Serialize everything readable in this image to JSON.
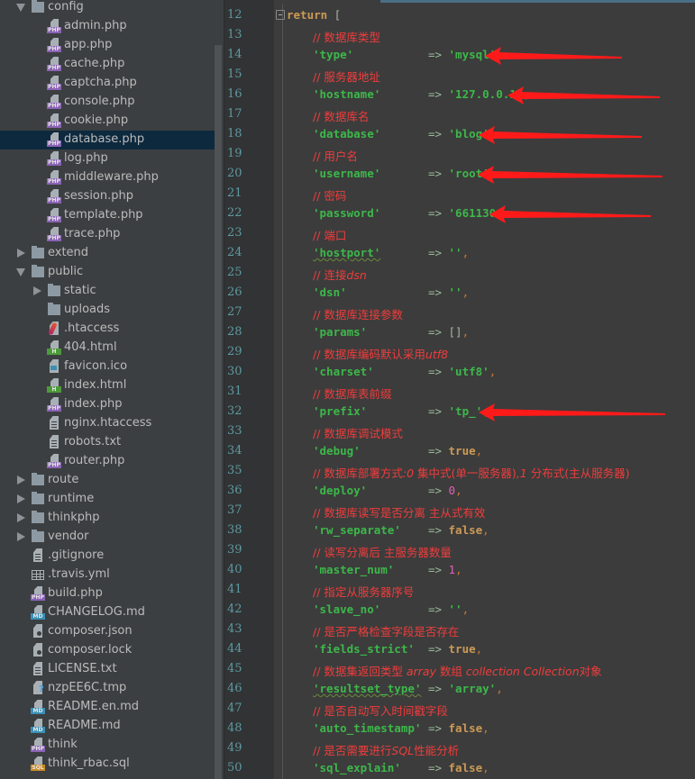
{
  "project_tree": {
    "items": [
      {
        "label": "config",
        "type": "folder",
        "expanded": true,
        "depth": 1
      },
      {
        "label": "admin.php",
        "type": "php",
        "depth": 2
      },
      {
        "label": "app.php",
        "type": "php",
        "depth": 2
      },
      {
        "label": "cache.php",
        "type": "php",
        "depth": 2
      },
      {
        "label": "captcha.php",
        "type": "php",
        "depth": 2
      },
      {
        "label": "console.php",
        "type": "php",
        "depth": 2
      },
      {
        "label": "cookie.php",
        "type": "php",
        "depth": 2
      },
      {
        "label": "database.php",
        "type": "php",
        "depth": 2,
        "selected": true
      },
      {
        "label": "log.php",
        "type": "php",
        "depth": 2
      },
      {
        "label": "middleware.php",
        "type": "php",
        "depth": 2
      },
      {
        "label": "session.php",
        "type": "php",
        "depth": 2
      },
      {
        "label": "template.php",
        "type": "php",
        "depth": 2
      },
      {
        "label": "trace.php",
        "type": "php",
        "depth": 2
      },
      {
        "label": "extend",
        "type": "folder",
        "expanded": false,
        "depth": 1
      },
      {
        "label": "public",
        "type": "folder",
        "expanded": true,
        "depth": 1
      },
      {
        "label": "static",
        "type": "folder",
        "expanded": false,
        "depth": 2
      },
      {
        "label": "uploads",
        "type": "folder-empty",
        "depth": 2
      },
      {
        "label": ".htaccess",
        "type": "apache",
        "depth": 2
      },
      {
        "label": "404.html",
        "type": "html",
        "depth": 2
      },
      {
        "label": "favicon.ico",
        "type": "image",
        "depth": 2
      },
      {
        "label": "index.html",
        "type": "html",
        "depth": 2
      },
      {
        "label": "index.php",
        "type": "php",
        "depth": 2
      },
      {
        "label": "nginx.htaccess",
        "type": "text",
        "depth": 2
      },
      {
        "label": "robots.txt",
        "type": "text",
        "depth": 2
      },
      {
        "label": "router.php",
        "type": "php",
        "depth": 2
      },
      {
        "label": "route",
        "type": "folder",
        "expanded": false,
        "depth": 1
      },
      {
        "label": "runtime",
        "type": "folder",
        "expanded": false,
        "depth": 1
      },
      {
        "label": "thinkphp",
        "type": "folder",
        "expanded": false,
        "depth": 1
      },
      {
        "label": "vendor",
        "type": "folder",
        "expanded": false,
        "depth": 1
      },
      {
        "label": ".gitignore",
        "type": "text",
        "depth": 1
      },
      {
        "label": ".travis.yml",
        "type": "yml",
        "depth": 1
      },
      {
        "label": "build.php",
        "type": "php",
        "depth": 1
      },
      {
        "label": "CHANGELOG.md",
        "type": "md",
        "depth": 1
      },
      {
        "label": "composer.json",
        "type": "composer",
        "depth": 1
      },
      {
        "label": "composer.lock",
        "type": "composer",
        "depth": 1
      },
      {
        "label": "LICENSE.txt",
        "type": "text",
        "depth": 1
      },
      {
        "label": "nzpEE6C.tmp",
        "type": "unknown",
        "depth": 1
      },
      {
        "label": "README.en.md",
        "type": "md",
        "depth": 1
      },
      {
        "label": "README.md",
        "type": "md",
        "depth": 1
      },
      {
        "label": "think",
        "type": "php",
        "depth": 1
      },
      {
        "label": "think_rbac.sql",
        "type": "sql",
        "depth": 1
      }
    ],
    "badges": {
      "php": "PHP",
      "html": "H",
      "md": "MD",
      "sql": "SQL"
    },
    "badge_colors": {
      "php": "#8a63b5",
      "html": "#4c9a3a",
      "md": "#3a8fb5",
      "sql": "#c98b25"
    }
  },
  "editor": {
    "lines": [
      {
        "n": "12",
        "tokens": [
          {
            "t": "return",
            "c": "kw"
          },
          {
            "t": " [",
            "c": "brk"
          }
        ],
        "fold": true
      },
      {
        "n": "13",
        "tokens": [
          {
            "t": "// 数据库类型",
            "c": "cm"
          }
        ]
      },
      {
        "n": "14",
        "tokens": [
          {
            "t": "'type'",
            "c": "str"
          },
          {
            "t": "           => ",
            "c": "op"
          },
          {
            "t": "'mysql'",
            "c": "str"
          },
          {
            "t": ",",
            "c": "punc"
          }
        ]
      },
      {
        "n": "15",
        "tokens": [
          {
            "t": "// 服务器地址",
            "c": "cm"
          }
        ]
      },
      {
        "n": "16",
        "tokens": [
          {
            "t": "'hostname'",
            "c": "str"
          },
          {
            "t": "       => ",
            "c": "op"
          },
          {
            "t": "'127.0.0.1'",
            "c": "str"
          },
          {
            "t": ",",
            "c": "punc"
          }
        ]
      },
      {
        "n": "17",
        "tokens": [
          {
            "t": "// 数据库名",
            "c": "cm"
          }
        ]
      },
      {
        "n": "18",
        "tokens": [
          {
            "t": "'database'",
            "c": "str"
          },
          {
            "t": "       => ",
            "c": "op"
          },
          {
            "t": "'blog'",
            "c": "str"
          },
          {
            "t": ",",
            "c": "punc"
          }
        ]
      },
      {
        "n": "19",
        "tokens": [
          {
            "t": "// 用户名",
            "c": "cm"
          }
        ]
      },
      {
        "n": "20",
        "tokens": [
          {
            "t": "'username'",
            "c": "str"
          },
          {
            "t": "       => ",
            "c": "op"
          },
          {
            "t": "'root'",
            "c": "str"
          },
          {
            "t": ",",
            "c": "punc"
          }
        ]
      },
      {
        "n": "21",
        "tokens": [
          {
            "t": "// 密码",
            "c": "cm"
          }
        ]
      },
      {
        "n": "22",
        "tokens": [
          {
            "t": "'password'",
            "c": "str"
          },
          {
            "t": "       => ",
            "c": "op"
          },
          {
            "t": "'661130'",
            "c": "str"
          }
        ]
      },
      {
        "n": "23",
        "tokens": [
          {
            "t": "// 端口",
            "c": "cm"
          }
        ]
      },
      {
        "n": "24",
        "tokens": [
          {
            "t": "'hostport'",
            "c": "str squig"
          },
          {
            "t": "       => ",
            "c": "op"
          },
          {
            "t": "''",
            "c": "str"
          },
          {
            "t": ",",
            "c": "punc"
          }
        ]
      },
      {
        "n": "25",
        "tokens": [
          {
            "t": "// 连接",
            "c": "cm"
          },
          {
            "t": "dsn",
            "c": "cm-i"
          }
        ]
      },
      {
        "n": "26",
        "tokens": [
          {
            "t": "'dsn'",
            "c": "str"
          },
          {
            "t": "            => ",
            "c": "op"
          },
          {
            "t": "''",
            "c": "str"
          },
          {
            "t": ",",
            "c": "punc"
          }
        ]
      },
      {
        "n": "27",
        "tokens": [
          {
            "t": "// 数据库连接参数",
            "c": "cm"
          }
        ]
      },
      {
        "n": "28",
        "tokens": [
          {
            "t": "'params'",
            "c": "str"
          },
          {
            "t": "         => ",
            "c": "op"
          },
          {
            "t": "[]",
            "c": "brk"
          },
          {
            "t": ",",
            "c": "punc"
          }
        ]
      },
      {
        "n": "29",
        "tokens": [
          {
            "t": "// 数据库编码默认采用",
            "c": "cm"
          },
          {
            "t": "utf8",
            "c": "cm-i"
          }
        ]
      },
      {
        "n": "30",
        "tokens": [
          {
            "t": "'charset'",
            "c": "str"
          },
          {
            "t": "        => ",
            "c": "op"
          },
          {
            "t": "'utf8'",
            "c": "str"
          },
          {
            "t": ",",
            "c": "punc"
          }
        ]
      },
      {
        "n": "31",
        "tokens": [
          {
            "t": "// 数据库表前缀",
            "c": "cm"
          }
        ]
      },
      {
        "n": "32",
        "tokens": [
          {
            "t": "'prefix'",
            "c": "str"
          },
          {
            "t": "         => ",
            "c": "op"
          },
          {
            "t": "'tp_'",
            "c": "str"
          },
          {
            "t": ",",
            "c": "punc"
          }
        ]
      },
      {
        "n": "33",
        "tokens": [
          {
            "t": "// 数据库调试模式",
            "c": "cm"
          }
        ]
      },
      {
        "n": "34",
        "tokens": [
          {
            "t": "'debug'",
            "c": "str"
          },
          {
            "t": "          => ",
            "c": "op"
          },
          {
            "t": "true",
            "c": "bool"
          },
          {
            "t": ",",
            "c": "punc"
          }
        ]
      },
      {
        "n": "35",
        "tokens": [
          {
            "t": "// 数据库部署方式",
            "c": "cm"
          },
          {
            "t": ":0 ",
            "c": "cm-i"
          },
          {
            "t": "集中式(单一服务器)",
            "c": "cm"
          },
          {
            "t": ",1 ",
            "c": "cm-i"
          },
          {
            "t": "分布式(主从服务器)",
            "c": "cm"
          }
        ]
      },
      {
        "n": "36",
        "tokens": [
          {
            "t": "'deploy'",
            "c": "str"
          },
          {
            "t": "         => ",
            "c": "op"
          },
          {
            "t": "0",
            "c": "num"
          },
          {
            "t": ",",
            "c": "punc"
          }
        ]
      },
      {
        "n": "37",
        "tokens": [
          {
            "t": "// 数据库读写是否分离 主从式有效",
            "c": "cm"
          }
        ]
      },
      {
        "n": "38",
        "tokens": [
          {
            "t": "'rw_separate'",
            "c": "str"
          },
          {
            "t": "    => ",
            "c": "op"
          },
          {
            "t": "false",
            "c": "bool"
          },
          {
            "t": ",",
            "c": "punc"
          }
        ]
      },
      {
        "n": "39",
        "tokens": [
          {
            "t": "// 读写分离后 主服务器数量",
            "c": "cm"
          }
        ]
      },
      {
        "n": "40",
        "tokens": [
          {
            "t": "'master_num'",
            "c": "str"
          },
          {
            "t": "     => ",
            "c": "op"
          },
          {
            "t": "1",
            "c": "num"
          },
          {
            "t": ",",
            "c": "punc"
          }
        ]
      },
      {
        "n": "41",
        "tokens": [
          {
            "t": "// 指定从服务器序号",
            "c": "cm"
          }
        ]
      },
      {
        "n": "42",
        "tokens": [
          {
            "t": "'slave_no'",
            "c": "str"
          },
          {
            "t": "       => ",
            "c": "op"
          },
          {
            "t": "''",
            "c": "str"
          },
          {
            "t": ",",
            "c": "punc"
          }
        ]
      },
      {
        "n": "43",
        "tokens": [
          {
            "t": "// 是否严格检查字段是否存在",
            "c": "cm"
          }
        ]
      },
      {
        "n": "44",
        "tokens": [
          {
            "t": "'fields_strict'",
            "c": "str"
          },
          {
            "t": "  => ",
            "c": "op"
          },
          {
            "t": "true",
            "c": "bool"
          },
          {
            "t": ",",
            "c": "punc"
          }
        ]
      },
      {
        "n": "45",
        "tokens": [
          {
            "t": "// 数据集返回类型 ",
            "c": "cm"
          },
          {
            "t": "array ",
            "c": "cm-i"
          },
          {
            "t": "数组 ",
            "c": "cm"
          },
          {
            "t": "collection Collection",
            "c": "cm-i"
          },
          {
            "t": "对象",
            "c": "cm"
          }
        ]
      },
      {
        "n": "46",
        "tokens": [
          {
            "t": "'resultset_type'",
            "c": "str squig"
          },
          {
            "t": " => ",
            "c": "op"
          },
          {
            "t": "'array'",
            "c": "str"
          },
          {
            "t": ",",
            "c": "punc"
          }
        ]
      },
      {
        "n": "47",
        "tokens": [
          {
            "t": "// 是否自动写入时间戳字段",
            "c": "cm"
          }
        ]
      },
      {
        "n": "48",
        "tokens": [
          {
            "t": "'auto_timestamp'",
            "c": "str"
          },
          {
            "t": " => ",
            "c": "op"
          },
          {
            "t": "false",
            "c": "bool"
          },
          {
            "t": ",",
            "c": "punc"
          }
        ]
      },
      {
        "n": "49",
        "tokens": [
          {
            "t": "// 是否需要进行",
            "c": "cm"
          },
          {
            "t": "SQL",
            "c": "cm-i"
          },
          {
            "t": "性能分析",
            "c": "cm"
          }
        ]
      },
      {
        "n": "50",
        "tokens": [
          {
            "t": "'sql_explain'",
            "c": "str"
          },
          {
            "t": "    => ",
            "c": "op"
          },
          {
            "t": "false",
            "c": "bool"
          },
          {
            "t": ",",
            "c": "punc"
          }
        ]
      }
    ]
  },
  "annotations": {
    "arrow_color": "#ff1a1a",
    "pointed_lines": [
      "14",
      "16",
      "18",
      "20",
      "22",
      "32"
    ]
  }
}
